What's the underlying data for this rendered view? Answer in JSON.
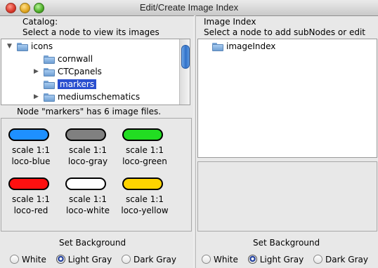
{
  "window": {
    "title": "Edit/Create Image Index"
  },
  "catalog": {
    "title": "Catalog:",
    "hint": "Select a node to view its images",
    "tree": [
      {
        "label": "icons",
        "expanded": true
      },
      {
        "label": "cornwall"
      },
      {
        "label": "CTCpanels",
        "collapsed": true
      },
      {
        "label": "markers",
        "selected": true
      },
      {
        "label": "mediumschematics",
        "collapsed": true
      }
    ],
    "status": "Node \"markers\" has 6 image files.",
    "images": [
      {
        "scale": "scale 1:1",
        "name": "loco-blue",
        "color": "#1e90ff"
      },
      {
        "scale": "scale 1:1",
        "name": "loco-gray",
        "color": "#808080"
      },
      {
        "scale": "scale 1:1",
        "name": "loco-green",
        "color": "#22dd22"
      },
      {
        "scale": "scale 1:1",
        "name": "loco-red",
        "color": "#ff1010"
      },
      {
        "scale": "scale 1:1",
        "name": "loco-white",
        "color": "#ffffff"
      },
      {
        "scale": "scale 1:1",
        "name": "loco-yellow",
        "color": "#ffd400"
      }
    ],
    "background": {
      "title": "Set Background",
      "options": [
        "White",
        "Light Gray",
        "Dark Gray"
      ],
      "selected": "Light Gray"
    }
  },
  "index": {
    "title": "Image Index",
    "hint": "Select a node to add subNodes or edit",
    "tree": [
      {
        "label": "imageIndex"
      }
    ],
    "background": {
      "title": "Set Background",
      "options": [
        "White",
        "Light Gray",
        "Dark Gray"
      ],
      "selected": "Light Gray"
    }
  }
}
